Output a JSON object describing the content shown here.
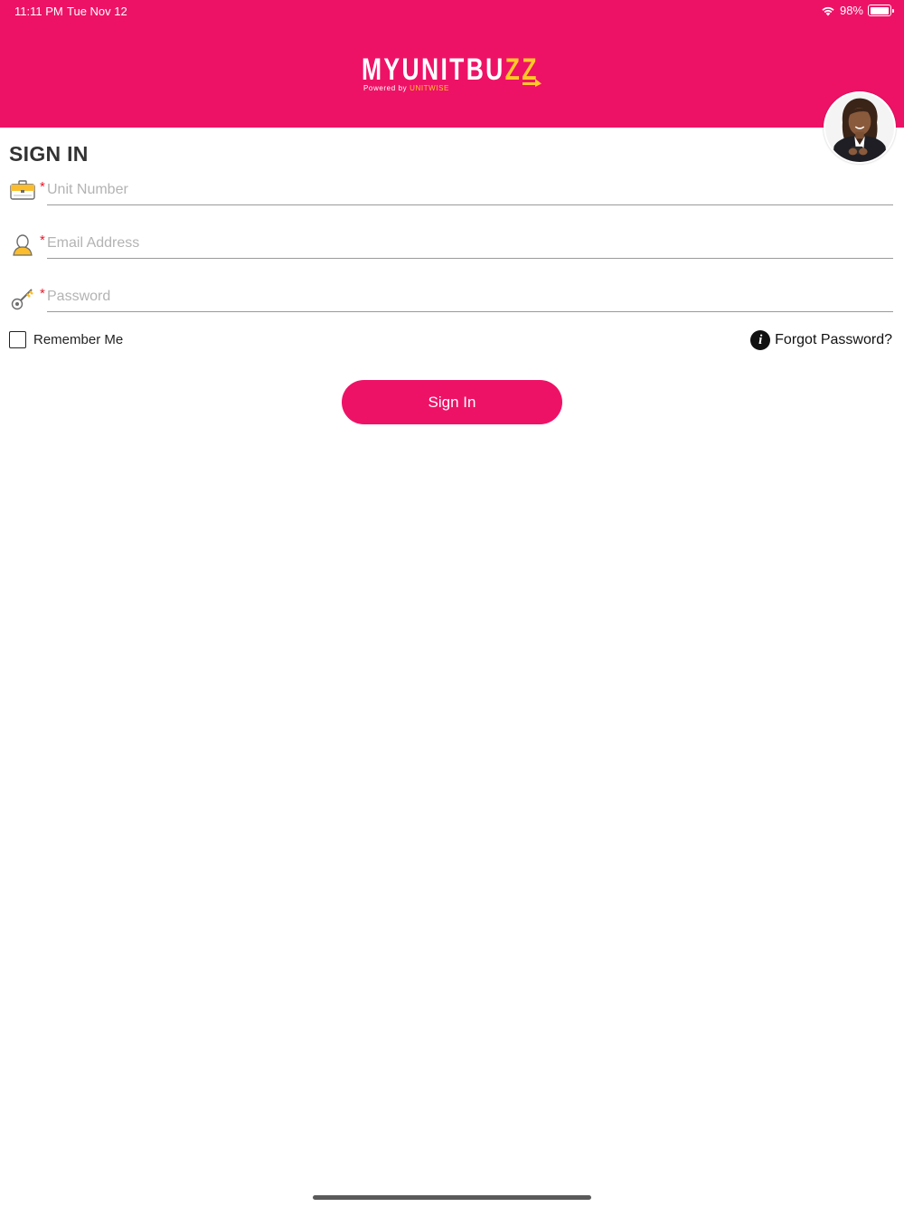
{
  "status_bar": {
    "time": "11:11 PM",
    "date": "Tue Nov 12",
    "battery": "98%",
    "battery_level": 0.98
  },
  "header": {
    "logo_main": "MYUNITBU",
    "logo_accent": "ZZ",
    "logo_powered": "Powered by ",
    "logo_brand": "UNITWISE",
    "colors": {
      "background": "#ee1266",
      "accent": "#ffc928"
    }
  },
  "avatar": {
    "icon": "user-avatar-photo"
  },
  "form": {
    "title": "SIGN IN",
    "required_mark": "*",
    "fields": [
      {
        "icon": "briefcase-icon",
        "placeholder": "Unit Number",
        "value": ""
      },
      {
        "icon": "user-icon",
        "placeholder": "Email Address",
        "value": ""
      },
      {
        "icon": "key-icon",
        "placeholder": "Password",
        "value": ""
      }
    ],
    "remember_me": {
      "label": "Remember Me",
      "checked": false
    },
    "forgot_password": {
      "label": "Forgot Password?",
      "icon": "info-icon",
      "icon_glyph": "i"
    },
    "submit_label": "Sign In"
  }
}
